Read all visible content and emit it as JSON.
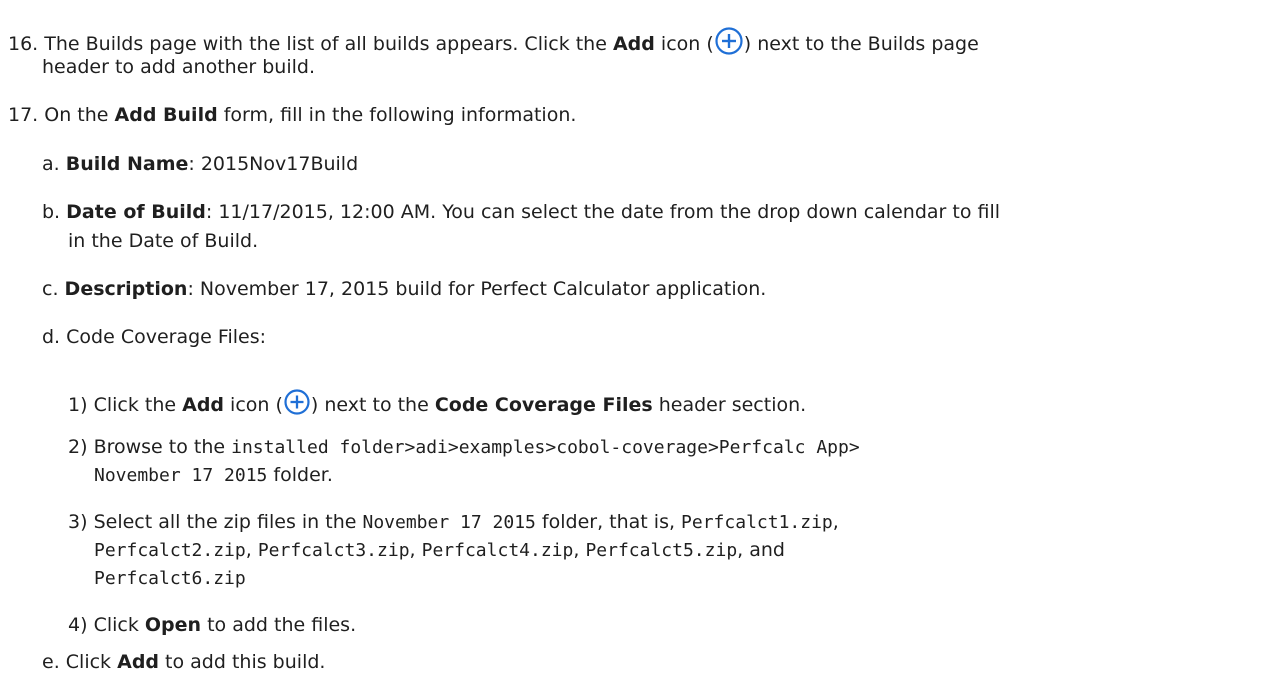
{
  "step16": {
    "num": "16.",
    "t1": "The Builds page with the list of all builds appears. Click the ",
    "add": "Add",
    "t2": " icon (",
    "t3": ") next to the Builds page",
    "t4": "header to add another build."
  },
  "step17": {
    "num": "17.",
    "t1": "On the ",
    "form": "Add Build",
    "t2": " form, fill in the following information."
  },
  "a": {
    "marker": "a.",
    "label": "Build Name",
    "value": ": 2015Nov17Build"
  },
  "b": {
    "marker": "b.",
    "label": "Date of Build",
    "value": ": 11/17/2015, 12:00 AM. You can select the date from the drop down calendar to fill",
    "cont": "in the Date of Build."
  },
  "c": {
    "marker": "c.",
    "label": "Description",
    "value": ": November 17, 2015 build for Perfect Calculator application."
  },
  "d": {
    "marker": "d.",
    "text": "Code Coverage Files:"
  },
  "d1": {
    "num": "1)",
    "t1": "Click the ",
    "add": "Add",
    "t2": " icon (",
    "t3": ") next to the ",
    "section": "Code Coverage Files",
    "t4": " header section."
  },
  "d2": {
    "num": "2)",
    "t1": "Browse to the ",
    "path1": "installed folder>adi>examples>cobol-coverage>Perfcalc App>",
    "path2": "November 17 2015",
    "t2": " folder."
  },
  "d3": {
    "num": "3)",
    "t1": "Select all the zip files in the ",
    "folder": "November 17 2015",
    "t2": " folder, that is, ",
    "f1": "Perfcalct1.zip",
    "comma": ",",
    "f2": "Perfcalct2.zip",
    "f3": "Perfcalct3.zip",
    "f4": "Perfcalct4.zip",
    "f5": "Perfcalct5.zip",
    "and": ", and",
    "f6": "Perfcalct6.zip",
    "sep": ", "
  },
  "d4": {
    "num": "4)",
    "t1": "Click ",
    "open": "Open",
    "t2": " to add the files."
  },
  "e": {
    "marker": "e.",
    "t1": "Click ",
    "add": "Add",
    "t2": " to add this build."
  },
  "colors": {
    "icon": "#1f6fd6",
    "text": "#1f1f1f"
  },
  "icons": [
    "add-circle-icon"
  ]
}
